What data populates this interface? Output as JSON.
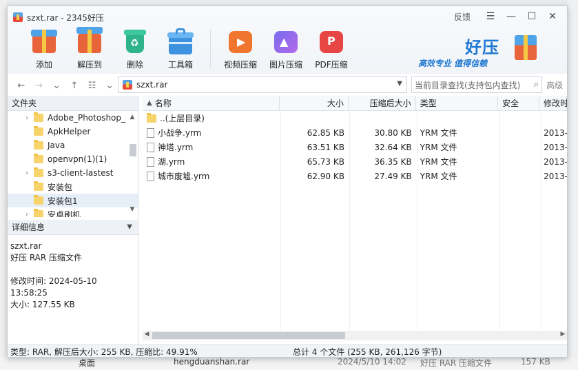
{
  "window": {
    "title": "szxt.rar - 2345好压",
    "feedback": "反馈"
  },
  "toolbar": {
    "items": [
      {
        "label": "添加",
        "icon": "add-icon"
      },
      {
        "label": "解压到",
        "icon": "extract-icon"
      },
      {
        "label": "删除",
        "icon": "delete-icon"
      },
      {
        "label": "工具箱",
        "icon": "toolbox-icon"
      },
      {
        "label": "视频压缩",
        "icon": "video-compress-icon"
      },
      {
        "label": "图片压缩",
        "icon": "image-compress-icon"
      },
      {
        "label": "PDF压缩",
        "icon": "pdf-compress-icon"
      }
    ]
  },
  "brand": {
    "name": "好压",
    "slogan": "高效专业  值得信赖"
  },
  "address": {
    "path": "szxt.rar",
    "search_placeholder": "当前目录查找(支持包内查找)",
    "advanced": "高级"
  },
  "folder_panel": {
    "title": "文件夹",
    "items": [
      {
        "label": "Adobe_Photoshop_",
        "expand": "›"
      },
      {
        "label": "ApkHelper",
        "expand": ""
      },
      {
        "label": "Java",
        "expand": ""
      },
      {
        "label": "openvpn(1)(1)",
        "expand": ""
      },
      {
        "label": "s3-client-lastest",
        "expand": "›"
      },
      {
        "label": "安装包",
        "expand": ""
      },
      {
        "label": "安装包1",
        "expand": ""
      },
      {
        "label": "安卓刷机",
        "expand": "›"
      }
    ]
  },
  "detail_panel": {
    "title": "详细信息",
    "filename": "szxt.rar",
    "filetype": "好压 RAR 压缩文件",
    "modified": "修改时间: 2024-05-10 13:58:25",
    "size": "大小: 127.55 KB"
  },
  "file_list": {
    "columns": {
      "name": "名称",
      "size": "大小",
      "compressed": "压缩后大小",
      "type": "类型",
      "security": "安全",
      "modified": "修改时"
    },
    "parent": "..(上层目录)",
    "rows": [
      {
        "name": "小战争.yrm",
        "size": "62.85 KB",
        "compressed": "30.80 KB",
        "type": "YRM 文件",
        "modified": "2013-"
      },
      {
        "name": "神塔.yrm",
        "size": "63.51 KB",
        "compressed": "32.64 KB",
        "type": "YRM 文件",
        "modified": "2013-"
      },
      {
        "name": "湖.yrm",
        "size": "65.73 KB",
        "compressed": "36.35 KB",
        "type": "YRM 文件",
        "modified": "2013-"
      },
      {
        "name": "城市废墟.yrm",
        "size": "62.90 KB",
        "compressed": "27.49 KB",
        "type": "YRM 文件",
        "modified": "2013-"
      }
    ]
  },
  "status": {
    "left": "类型: RAR, 解压后大小: 255 KB, 压缩比: 49.91%",
    "right": "总计 4 个文件 (255 KB, 261,126 字节)"
  },
  "background": {
    "desktop": "桌面",
    "file": "hengduanshan.rar",
    "date": "2024/5/10 14:02",
    "type": "好压 RAR 压缩文件",
    "size": "157 KB"
  },
  "colors": {
    "accent": "#1f78d1",
    "folder": "#f7d36b"
  }
}
